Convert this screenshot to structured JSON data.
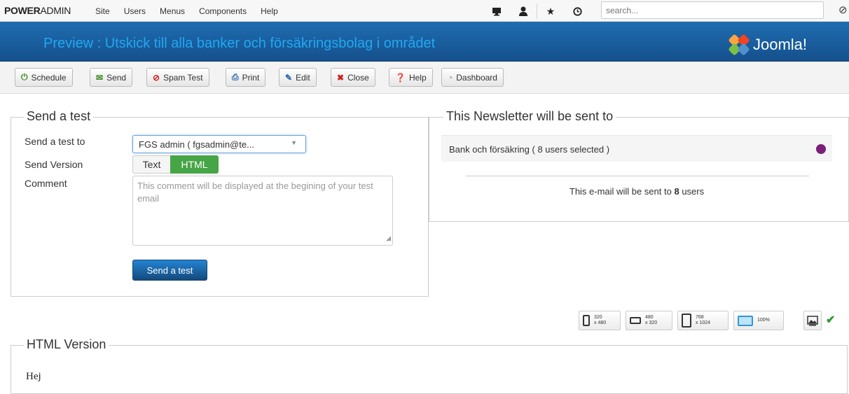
{
  "topbar": {
    "brand_bold": "POWER",
    "brand_rest": "ADMIN",
    "menu": [
      "Site",
      "Users",
      "Menus",
      "Components",
      "Help"
    ],
    "search_placeholder": "search...",
    "icons": [
      "monitor-icon",
      "user-icon",
      "star-icon",
      "clock-icon",
      "partial-icon"
    ]
  },
  "header": {
    "title": "Preview : Utskick till alla banker och försäkringsbolag i området",
    "logo_text": "Joomla!"
  },
  "toolbar": {
    "buttons": [
      {
        "label": "Schedule",
        "icon": "schedule-icon",
        "color": "#3a8a1f"
      },
      {
        "label": "Send",
        "icon": "send-icon",
        "color": "#3a8a1f"
      },
      {
        "label": "Spam Test",
        "icon": "spam-icon",
        "color": "#cc2222"
      },
      {
        "label": "Print",
        "icon": "print-icon",
        "color": "#2a66b0"
      },
      {
        "label": "Edit",
        "icon": "edit-icon",
        "color": "#2a66b0"
      },
      {
        "label": "Close",
        "icon": "close-icon",
        "color": "#cc2222"
      },
      {
        "label": "Help",
        "icon": "help-icon",
        "color": "#222222"
      },
      {
        "label": "Dashboard",
        "icon": "dashboard-icon",
        "color": "#999999"
      }
    ]
  },
  "send_test": {
    "legend": "Send a test",
    "send_to_label": "Send a test to",
    "send_to_value": "FGS admin ( fgsadmin@te...",
    "version_label": "Send Version",
    "version_options": [
      "Text",
      "HTML"
    ],
    "version_selected": "HTML",
    "comment_label": "Comment",
    "comment_placeholder": "This comment will be displayed at the begining of your test email",
    "submit_label": "Send a test"
  },
  "recipients": {
    "legend": "This Newsletter will be sent to",
    "list_item": "Bank och försäkring ( 8 users selected )",
    "sent_prefix": "This e-mail will be sent to",
    "sent_count": "8",
    "sent_suffix": "users",
    "dot_color": "#7a1f7a"
  },
  "preview_sizes": [
    {
      "label_top": "320",
      "label_bottom": "x 480"
    },
    {
      "label_top": "480",
      "label_bottom": "x 320"
    },
    {
      "label_top": "768",
      "label_bottom": "x 1024"
    },
    {
      "label_top": "100%",
      "label_bottom": ""
    }
  ],
  "html_version": {
    "legend": "HTML Version",
    "body_text": "Hej"
  },
  "colors": {
    "header_blue": "#1e6db1",
    "title_text": "#22a8f0",
    "html_toggle_green": "#46a546",
    "primary_button": "#1d6fb8"
  }
}
